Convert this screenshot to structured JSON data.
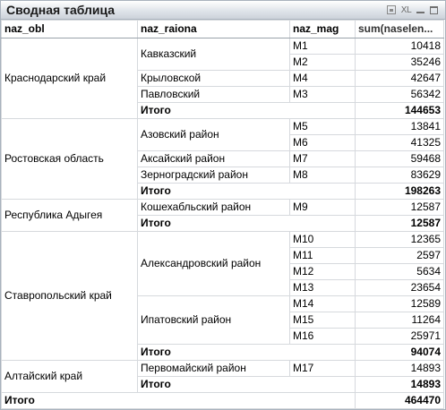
{
  "window": {
    "title": "Сводная таблица",
    "icons": [
      "print-icon",
      "xl-export-icon",
      "minimize-icon",
      "maximize-icon"
    ],
    "xl_label": "XL"
  },
  "columns": [
    "naz_obl",
    "naz_raiona",
    "naz_mag",
    "sum(naselen..."
  ],
  "total_label": "Итого",
  "groups": [
    {
      "obl": "Краснодарский край",
      "raions": [
        {
          "name": "Кавказский",
          "rows": [
            {
              "mag": "M1",
              "value": "10418"
            },
            {
              "mag": "M2",
              "value": "35246"
            }
          ]
        },
        {
          "name": "Крыловской",
          "rows": [
            {
              "mag": "M4",
              "value": "42647"
            }
          ]
        },
        {
          "name": "Павловский",
          "rows": [
            {
              "mag": "M3",
              "value": "56342"
            }
          ]
        }
      ],
      "total": "144653"
    },
    {
      "obl": "Ростовская область",
      "raions": [
        {
          "name": "Азовский район",
          "rows": [
            {
              "mag": "M5",
              "value": "13841"
            },
            {
              "mag": "M6",
              "value": "41325"
            }
          ]
        },
        {
          "name": "Аксайский район",
          "rows": [
            {
              "mag": "M7",
              "value": "59468"
            }
          ]
        },
        {
          "name": "Зерноградский район",
          "rows": [
            {
              "mag": "M8",
              "value": "83629"
            }
          ]
        }
      ],
      "total": "198263"
    },
    {
      "obl": "Республика Адыгея",
      "raions": [
        {
          "name": "Кошехабльский район",
          "rows": [
            {
              "mag": "M9",
              "value": "12587"
            }
          ]
        }
      ],
      "total": "12587"
    },
    {
      "obl": "Ставропольский край",
      "raions": [
        {
          "name": "Александровский район",
          "rows": [
            {
              "mag": "M10",
              "value": "12365"
            },
            {
              "mag": "M11",
              "value": "2597"
            },
            {
              "mag": "M12",
              "value": "5634"
            },
            {
              "mag": "M13",
              "value": "23654"
            }
          ]
        },
        {
          "name": "Ипатовский район",
          "rows": [
            {
              "mag": "M14",
              "value": "12589"
            },
            {
              "mag": "M15",
              "value": "11264"
            },
            {
              "mag": "M16",
              "value": "25971"
            }
          ]
        }
      ],
      "total": "94074"
    },
    {
      "obl": "Алтайский край",
      "raions": [
        {
          "name": "Первомайский район",
          "rows": [
            {
              "mag": "M17",
              "value": "14893"
            }
          ]
        }
      ],
      "total": "14893"
    }
  ],
  "grand_total": {
    "label": "Итого",
    "value": "464470"
  }
}
